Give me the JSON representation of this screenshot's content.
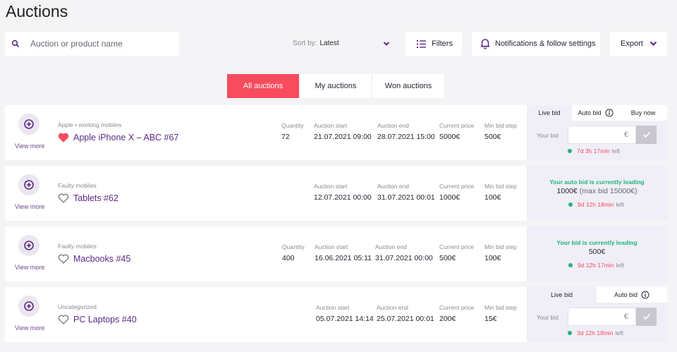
{
  "page": {
    "title": "Auctions"
  },
  "search": {
    "placeholder": "Auction or product name"
  },
  "sort": {
    "label": "Sort by:",
    "value": "Latest"
  },
  "toolbar": {
    "filters_label": "Filters",
    "notifications_label": "Notifications & follow settings",
    "export_label": "Export"
  },
  "tabs": [
    "All auctions",
    "My auctions",
    "Won auctions"
  ],
  "labels": {
    "quantity": "Quantity",
    "auction_start": "Auction start",
    "auction_end": "Auction end",
    "current_price": "Current price",
    "min_bid_step": "Min bid step",
    "view_more": "View more",
    "live_bid": "Live bid",
    "auto_bid": "Auto bid",
    "buy_now": "Buy now",
    "your_bid": "Your bid",
    "currency": "€",
    "left": "left"
  },
  "auctions": [
    {
      "category": "Apple • working mobiles",
      "name": "Apple iPhone X – ABC #67",
      "favorited": true,
      "quantity": "72",
      "start": "21.07.2021 09:00",
      "end": "28.07.2021 15:00",
      "current_price": "5000€",
      "min_bid_step": "500€",
      "time_left": "7d 3h 17min"
    },
    {
      "category": "Faulty mobiles",
      "name": "Tablets #62",
      "favorited": false,
      "start": "12.07.2021 00:00",
      "end": "31.07.2021 00:01",
      "current_price": "1000€",
      "min_bid_step": "100€",
      "status": "Your auto bid is currently leading",
      "status_value": "1000€",
      "status_extra": "(max bid 15000€)",
      "time_left": "9d 12h 18min"
    },
    {
      "category": "Faulty mobiles",
      "name": "Macbooks #45",
      "favorited": false,
      "quantity": "400",
      "start": "16.06.2021 05:11",
      "end": "31.07.2021 00:00",
      "current_price": "500€",
      "min_bid_step": "100€",
      "status": "Your bid is currently leading",
      "status_value": "500€",
      "time_left": "9d 12h 17min"
    },
    {
      "category": "Uncategorized",
      "name": "PC Laptops #40",
      "favorited": false,
      "start": "05.07.2021 14:14",
      "end": "25.07.2021 00:01",
      "current_price": "200€",
      "min_bid_step": "15€",
      "time_left": "3d 12h 18min"
    }
  ],
  "colors": {
    "accent": "#f64c5e",
    "brand": "#5b2a86",
    "success": "#20b57a"
  }
}
